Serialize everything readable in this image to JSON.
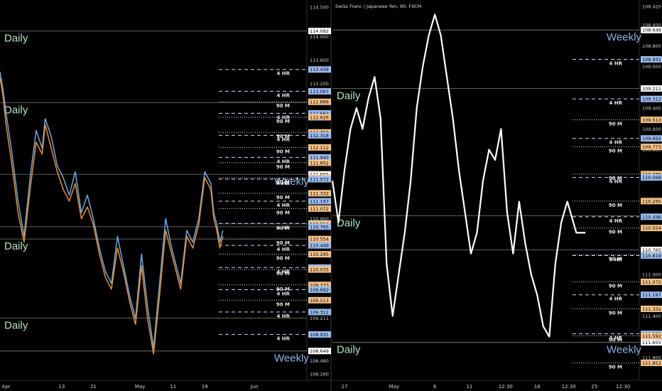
{
  "chart_data": [
    {
      "type": "line",
      "panel": "left",
      "title": "",
      "ylim": [
        108.15,
        114.62
      ],
      "axis_ticks": [
        "114.500",
        "114.092",
        "114.000",
        "113.600",
        "113.200",
        "112.875",
        "112.368",
        "111.852",
        "111.592",
        "110.900",
        "110.436",
        "109.211",
        "108.480",
        "108.260"
      ],
      "x_ticks": [
        {
          "label": "Apr",
          "t": 0.02
        },
        {
          "label": "13",
          "t": 0.205
        },
        {
          "label": "21",
          "t": 0.31
        },
        {
          "label": "May",
          "t": 0.465
        },
        {
          "label": "11",
          "t": 0.575
        },
        {
          "label": "19",
          "t": 0.68
        },
        {
          "label": "Jun",
          "t": 0.845
        }
      ],
      "levels": [
        {
          "price": 114.092,
          "style": "solid",
          "label": "Daily",
          "color": "#b9e4c4",
          "tag": "114.092",
          "tag_color": "#ffffff"
        },
        {
          "price": 113.438,
          "style": "dash",
          "tf": "4 HR",
          "tag": "113.438",
          "tag_color": "#9bbcf0"
        },
        {
          "price": 113.067,
          "style": "dash",
          "tf": "4 HR",
          "tag": "113.067",
          "tag_color": "#9bbcf0"
        },
        {
          "price": 112.888,
          "style": "dot",
          "tf": "90 M",
          "tag": "112.888",
          "tag_color": "#f5c28a"
        },
        {
          "price": 112.875,
          "style": "solid",
          "label": "Daily",
          "color": "#b9e4c4"
        },
        {
          "price": 112.692,
          "style": "dash",
          "tf": "4 HR",
          "tag": "112.692",
          "tag_color": "#9bbcf0"
        },
        {
          "price": 112.626,
          "style": "dot",
          "tf": "90 M",
          "tag": "112.626",
          "tag_color": "#f5c28a"
        },
        {
          "price": 112.368,
          "style": "dot",
          "tf": "90 M",
          "tag": "112.368",
          "tag_color": "#f5c28a"
        },
        {
          "price": 112.318,
          "style": "dash",
          "tf": "4 HR",
          "tag": "112.318",
          "tag_color": "#9bbcf0"
        },
        {
          "price": 112.112,
          "style": "dot",
          "tf": "90 M",
          "tag": "112.112",
          "tag_color": "#f5c28a"
        },
        {
          "price": 111.943,
          "style": "dash",
          "tf": "4 HR",
          "tag": "111.943",
          "tag_color": "#9bbcf0"
        },
        {
          "price": 111.852,
          "style": "dot",
          "tf": "90 M",
          "tag": "111.852",
          "tag_color": "#f5c28a"
        },
        {
          "price": 111.655,
          "style": "solid",
          "label": "Weekly",
          "color": "#8fb4e8",
          "tag": "111.655",
          "tag_color": "#ffffff"
        },
        {
          "price": 111.592,
          "style": "dot",
          "tf": "90 M",
          "tag": "111.592",
          "tag_color": "#f5c28a"
        },
        {
          "price": 111.572,
          "style": "dash",
          "tf": "4 HR",
          "tag": "111.572",
          "tag_color": "#9bbcf0"
        },
        {
          "price": 111.332,
          "style": "dot",
          "tf": "90 M",
          "tag": "111.332",
          "tag_color": "#f5c28a"
        },
        {
          "price": 111.197,
          "style": "dash",
          "tf": "4 HR",
          "tag": "111.197",
          "tag_color": "#9bbcf0"
        },
        {
          "price": 111.072,
          "style": "dot",
          "tf": "90 M",
          "tag": "111.072",
          "tag_color": "#f5c28a"
        },
        {
          "price": 110.819,
          "style": "dash",
          "tf": "4 HR",
          "tag": "110.819",
          "tag_color": "#9bbcf0"
        },
        {
          "price": 110.812,
          "style": "dot",
          "tf": "90 M",
          "tag": "110.812",
          "tag_color": "#f5c28a"
        },
        {
          "price": 110.765,
          "style": "solid",
          "tag": "110.765",
          "tag_color": "#9bbcf0"
        },
        {
          "price": 110.554,
          "style": "dot",
          "tf": "90 M",
          "tag": "110.554",
          "tag_color": "#f5c28a"
        },
        {
          "price": 110.554,
          "style": "solid",
          "label": "Daily",
          "color": "#b9e4c4"
        },
        {
          "price": 110.446,
          "style": "dash",
          "tf": "4 HR",
          "tag": "110.446",
          "tag_color": "#9bbcf0"
        },
        {
          "price": 110.295,
          "style": "dot",
          "tf": "90 M",
          "tag": "110.295",
          "tag_color": "#f5c28a"
        },
        {
          "price": 110.068,
          "style": "dash",
          "tf": "4 HR",
          "tag": "110.068",
          "tag_color": "#9bbcf0"
        },
        {
          "price": 110.035,
          "style": "dot",
          "tf": "90 M",
          "tag": "110.035",
          "tag_color": "#f5c28a"
        },
        {
          "price": 109.773,
          "style": "dot",
          "tf": "90 M",
          "tag": "109.773",
          "tag_color": "#f5c28a"
        },
        {
          "price": 109.692,
          "style": "dash",
          "tf": "4 HR",
          "tag": "109.692",
          "tag_color": "#9bbcf0"
        },
        {
          "price": 109.513,
          "style": "dot",
          "tf": "90 M",
          "tag": "109.513",
          "tag_color": "#f5c28a"
        },
        {
          "price": 109.312,
          "style": "dash",
          "tf": "4 HR",
          "tag": "109.312",
          "tag_color": "#9bbcf0"
        },
        {
          "price": 109.211,
          "style": "solid",
          "label": "Daily",
          "color": "#b9e4c4"
        },
        {
          "price": 108.931,
          "style": "dash",
          "tf": "4 HR",
          "tag": "108.931",
          "tag_color": "#9bbcf0"
        },
        {
          "price": 108.649,
          "style": "solid",
          "label": "Weekly",
          "color": "#8fb4e8",
          "tag": "108.649",
          "tag_color": "#ffffff"
        }
      ],
      "series": [
        {
          "name": "",
          "color": "#6fa8dc",
          "x": [
            0,
            0.01,
            0.02,
            0.04,
            0.06,
            0.08,
            0.1,
            0.12,
            0.14,
            0.15,
            0.17,
            0.19,
            0.21,
            0.23,
            0.25,
            0.27,
            0.29,
            0.31,
            0.33,
            0.35,
            0.37,
            0.39,
            0.41,
            0.43,
            0.45,
            0.47,
            0.49,
            0.51,
            0.53,
            0.55,
            0.57,
            0.59,
            0.6,
            0.62,
            0.64,
            0.66,
            0.68,
            0.7,
            0.71,
            0.72,
            0.73,
            0.74
          ],
          "y": [
            113.4,
            113.1,
            112.7,
            112.0,
            111.2,
            110.6,
            111.6,
            112.4,
            112.1,
            112.6,
            112.3,
            111.8,
            111.6,
            111.3,
            111.7,
            111.0,
            111.3,
            110.9,
            110.4,
            110.0,
            109.8,
            110.6,
            110.1,
            109.6,
            109.2,
            110.3,
            109.4,
            108.7,
            109.8,
            110.9,
            110.4,
            110.0,
            109.8,
            110.7,
            110.5,
            110.9,
            111.7,
            111.5,
            111.0,
            110.8,
            110.5,
            110.7
          ]
        },
        {
          "name": "",
          "color": "#e69138",
          "x": [
            0,
            0.01,
            0.02,
            0.04,
            0.06,
            0.08,
            0.1,
            0.12,
            0.14,
            0.15,
            0.17,
            0.19,
            0.21,
            0.23,
            0.25,
            0.27,
            0.29,
            0.31,
            0.33,
            0.35,
            0.37,
            0.39,
            0.41,
            0.43,
            0.45,
            0.47,
            0.49,
            0.51,
            0.53,
            0.55,
            0.57,
            0.59,
            0.6,
            0.62,
            0.64,
            0.66,
            0.68,
            0.7,
            0.71,
            0.72,
            0.73,
            0.74
          ],
          "y": [
            113.3,
            113.0,
            112.5,
            111.8,
            111.0,
            110.5,
            111.4,
            112.2,
            112.0,
            112.5,
            112.1,
            111.7,
            111.4,
            111.2,
            111.5,
            110.9,
            111.1,
            110.8,
            110.3,
            109.9,
            109.7,
            110.4,
            110.0,
            109.5,
            109.1,
            110.1,
            109.2,
            108.6,
            109.6,
            110.7,
            110.3,
            109.9,
            109.7,
            110.6,
            110.4,
            110.8,
            111.6,
            111.4,
            110.9,
            110.7,
            110.4,
            110.6
          ]
        }
      ]
    },
    {
      "type": "line",
      "panel": "right",
      "title": "Swiss Franc / Japanese Yen, 90, FXCM",
      "inverted": true,
      "ylim": [
        108.36,
        112.02
      ],
      "axis_ticks": [
        "108.420",
        "108.600",
        "108.800",
        "109.000",
        "109.211",
        "109.400",
        "109.600",
        "109.800",
        "110.436",
        "110.765",
        "111.000",
        "111.200",
        "111.400",
        "111.600",
        "111.800"
      ],
      "x_ticks": [
        {
          "label": "27",
          "t": 0.04
        },
        {
          "label": "May",
          "t": 0.205
        },
        {
          "label": "6",
          "t": 0.34
        },
        {
          "label": "11",
          "t": 0.455
        },
        {
          "label": "12:30",
          "t": 0.575
        },
        {
          "label": "18",
          "t": 0.68
        },
        {
          "label": "12:30",
          "t": 0.785
        },
        {
          "label": "25",
          "t": 0.87
        },
        {
          "label": "12:30",
          "t": 0.965
        }
      ],
      "levels": [
        {
          "price": 108.649,
          "style": "solid",
          "label": "Weekly",
          "color": "#8fb4e8",
          "tag": "108.649",
          "tag_color": "#ffffff"
        },
        {
          "price": 108.931,
          "style": "dash",
          "tf": "4 HR",
          "tag": "108.931",
          "tag_color": "#9bbcf0"
        },
        {
          "price": 109.211,
          "style": "solid",
          "label": "Daily",
          "color": "#b9e4c4",
          "tag": "109.211",
          "tag_color": "#ffffff"
        },
        {
          "price": 109.312,
          "style": "dash",
          "tf": "4 HR",
          "tag": "109.312",
          "tag_color": "#9bbcf0"
        },
        {
          "price": 109.513,
          "style": "dot",
          "tf": "90 M",
          "tag": "109.513",
          "tag_color": "#f5c28a"
        },
        {
          "price": 109.692,
          "style": "dash",
          "tf": "4 HR",
          "tag": "109.692",
          "tag_color": "#9bbcf0"
        },
        {
          "price": 109.773,
          "style": "dot",
          "tf": "90 M",
          "tag": "109.773",
          "tag_color": "#f5c28a"
        },
        {
          "price": 110.035,
          "style": "dot",
          "tf": "90 M",
          "tag": "110.035",
          "tag_color": "#f5c28a"
        },
        {
          "price": 110.068,
          "style": "dash",
          "tf": "4 HR",
          "tag": "110.068",
          "tag_color": "#9bbcf0"
        },
        {
          "price": 110.295,
          "style": "dot",
          "tf": "90 M",
          "tag": "110.295",
          "tag_color": "#f5c28a"
        },
        {
          "price": 110.436,
          "style": "solid",
          "label": "Daily",
          "color": "#b9e4c4"
        },
        {
          "price": 110.446,
          "style": "dash",
          "tf": "4 HR",
          "tag": "110.446",
          "tag_color": "#9bbcf0"
        },
        {
          "price": 110.554,
          "style": "dot",
          "tf": "90 M",
          "tag": "110.554",
          "tag_color": "#f5c28a"
        },
        {
          "price": 110.765,
          "style": "solid",
          "tag": "110.765",
          "tag_color": "#ffffff"
        },
        {
          "price": 110.812,
          "style": "dot",
          "tf": "90 M",
          "tag": "110.812",
          "tag_color": "#f5c28a"
        },
        {
          "price": 110.819,
          "style": "dash",
          "tf": "4 HR",
          "tag": "110.819",
          "tag_color": "#9bbcf0"
        },
        {
          "price": 111.072,
          "style": "dot",
          "tf": "90 M",
          "tag": "111.072",
          "tag_color": "#f5c28a"
        },
        {
          "price": 111.197,
          "style": "dash",
          "tf": "4 HR",
          "tag": "111.197",
          "tag_color": "#9bbcf0"
        },
        {
          "price": 111.332,
          "style": "dot",
          "tf": "90 M",
          "tag": "111.332",
          "tag_color": "#f5c28a"
        },
        {
          "price": 111.572,
          "style": "dash",
          "tf": "4 HR",
          "tag": "111.572",
          "tag_color": "#9bbcf0"
        },
        {
          "price": 111.592,
          "style": "dot",
          "tf": "90 M",
          "tag": "111.592",
          "tag_color": "#f5c28a"
        },
        {
          "price": 111.655,
          "style": "solid",
          "label": "Weekly",
          "color": "#8fb4e8",
          "tag": "111.655",
          "tag_color": "#ffffff"
        },
        {
          "price": 111.852,
          "style": "dot",
          "tf": "90 M",
          "tag": "111.852",
          "tag_color": "#f5c28a"
        },
        {
          "price": 111.655,
          "style": "solid",
          "label": "Daily",
          "color": "#b9e4c4"
        }
      ],
      "series": [
        {
          "name": "",
          "color": "#ffffff",
          "x": [
            0,
            0.02,
            0.04,
            0.06,
            0.08,
            0.1,
            0.12,
            0.14,
            0.16,
            0.18,
            0.2,
            0.22,
            0.24,
            0.26,
            0.28,
            0.3,
            0.32,
            0.34,
            0.36,
            0.38,
            0.4,
            0.42,
            0.44,
            0.46,
            0.48,
            0.5,
            0.52,
            0.54,
            0.56,
            0.58,
            0.6,
            0.62,
            0.64,
            0.66,
            0.68,
            0.7,
            0.72,
            0.74,
            0.76,
            0.78,
            0.8,
            0.81,
            0.82,
            0.83,
            0.84
          ],
          "y": [
            110.1,
            110.5,
            110.0,
            109.6,
            109.4,
            109.6,
            109.3,
            109.1,
            109.5,
            110.9,
            111.4,
            111.0,
            110.6,
            110.1,
            109.4,
            109.0,
            108.7,
            108.5,
            108.7,
            109.1,
            109.5,
            110.0,
            110.4,
            110.8,
            110.6,
            110.1,
            109.8,
            109.9,
            109.6,
            110.4,
            110.8,
            110.3,
            110.7,
            111.0,
            111.2,
            111.5,
            111.6,
            110.9,
            110.5,
            110.3,
            110.5,
            110.6,
            110.6,
            110.6,
            110.6
          ]
        }
      ]
    }
  ]
}
